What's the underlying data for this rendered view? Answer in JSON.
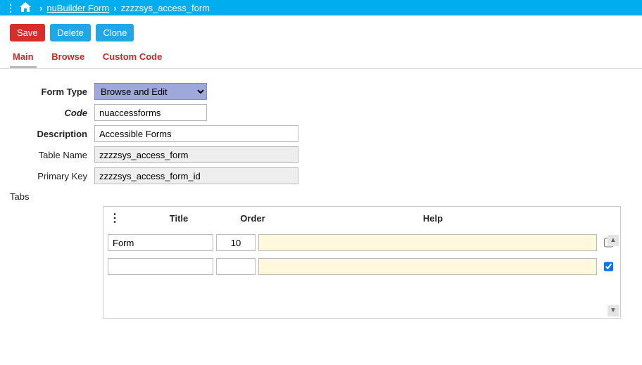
{
  "breadcrumb": {
    "app": "nuBuilder Form",
    "page": "zzzzsys_access_form"
  },
  "toolbar": {
    "save": "Save",
    "delete": "Delete",
    "clone": "Clone"
  },
  "tabs": {
    "main": "Main",
    "browse": "Browse",
    "custom": "Custom Code"
  },
  "labels": {
    "form_type": "Form Type",
    "code": "Code",
    "description": "Description",
    "table_name": "Table Name",
    "primary_key": "Primary Key",
    "tabs": "Tabs"
  },
  "fields": {
    "form_type": "Browse and Edit",
    "code": "nuaccessforms",
    "description": "Accessible Forms",
    "table_name": "zzzzsys_access_form",
    "primary_key": "zzzzsys_access_form_id"
  },
  "grid": {
    "headers": {
      "title": "Title",
      "order": "Order",
      "help": "Help"
    },
    "rows": [
      {
        "title": "Form",
        "order": "10",
        "help": "",
        "checked": false
      },
      {
        "title": "",
        "order": "",
        "help": "",
        "checked": true
      }
    ]
  }
}
